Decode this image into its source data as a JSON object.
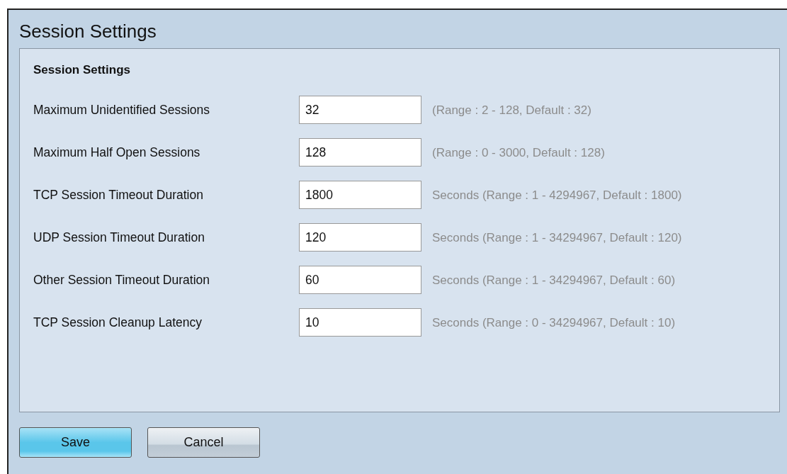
{
  "page_title": "Session Settings",
  "section": {
    "title": "Session Settings",
    "fields": [
      {
        "label": "Maximum Unidentified Sessions",
        "value": "32",
        "hint": "(Range : 2 - 128, Default : 32)"
      },
      {
        "label": "Maximum Half Open Sessions",
        "value": "128",
        "hint": "(Range : 0 - 3000, Default : 128)"
      },
      {
        "label": "TCP Session Timeout Duration",
        "value": "1800",
        "hint": "Seconds (Range : 1 - 4294967, Default : 1800)"
      },
      {
        "label": "UDP Session Timeout Duration",
        "value": "120",
        "hint": "Seconds (Range : 1 - 34294967, Default : 120)"
      },
      {
        "label": "Other Session Timeout Duration",
        "value": "60",
        "hint": "Seconds (Range : 1 - 34294967, Default : 60)"
      },
      {
        "label": "TCP Session Cleanup Latency",
        "value": "10",
        "hint": "Seconds (Range : 0 - 34294967, Default : 10)"
      }
    ]
  },
  "buttons": [
    {
      "label": "Save",
      "kind": "primary"
    },
    {
      "label": "Cancel",
      "kind": "secondary"
    }
  ]
}
